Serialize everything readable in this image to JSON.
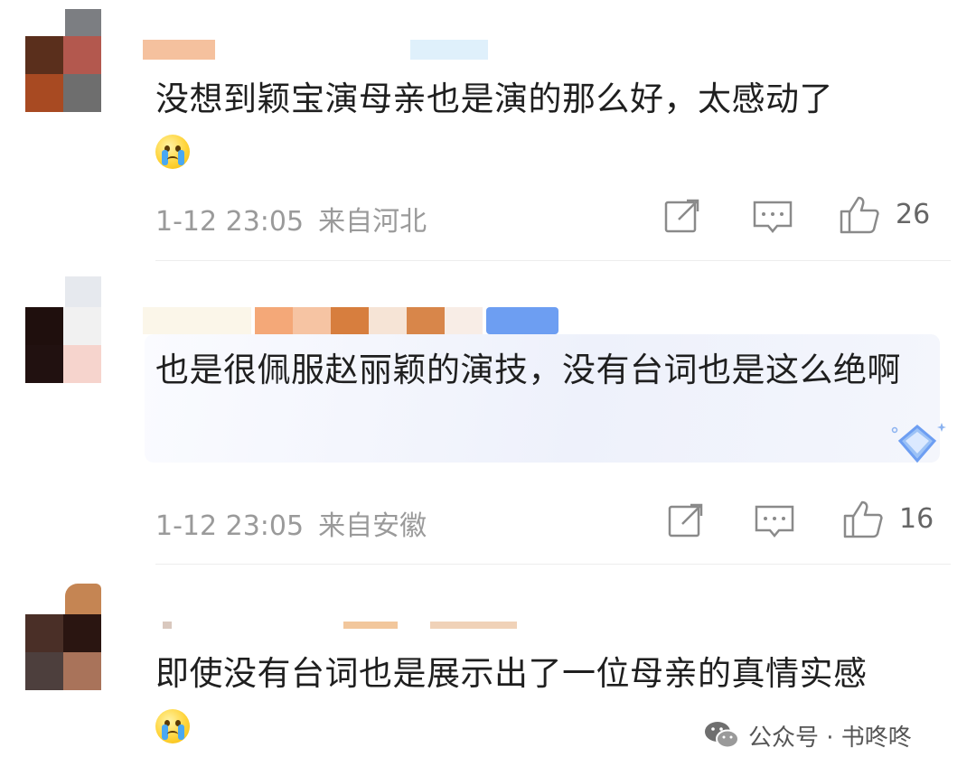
{
  "comments": [
    {
      "text": "没想到颖宝演母亲也是演的那么好，太感动了",
      "emoji": "crying-face-icon",
      "time": "1-12 23:05",
      "location": "来自河北",
      "likes": "26"
    },
    {
      "text": "也是很佩服赵丽颖的演技，没有台词也是这么绝啊",
      "time": "1-12 23:05",
      "location": "来自安徽",
      "likes": "16"
    },
    {
      "text": "即使没有台词也是展示出了一位母亲的真情实感",
      "emoji": "crying-face-icon"
    }
  ],
  "watermark": {
    "label": "公众号 · 书咚咚",
    "icon": "wechat-icon"
  },
  "colors": {
    "text": "#1f1f1f",
    "meta": "#9a9a9a",
    "divider": "#ededed",
    "highlight": "#eef1fb"
  }
}
